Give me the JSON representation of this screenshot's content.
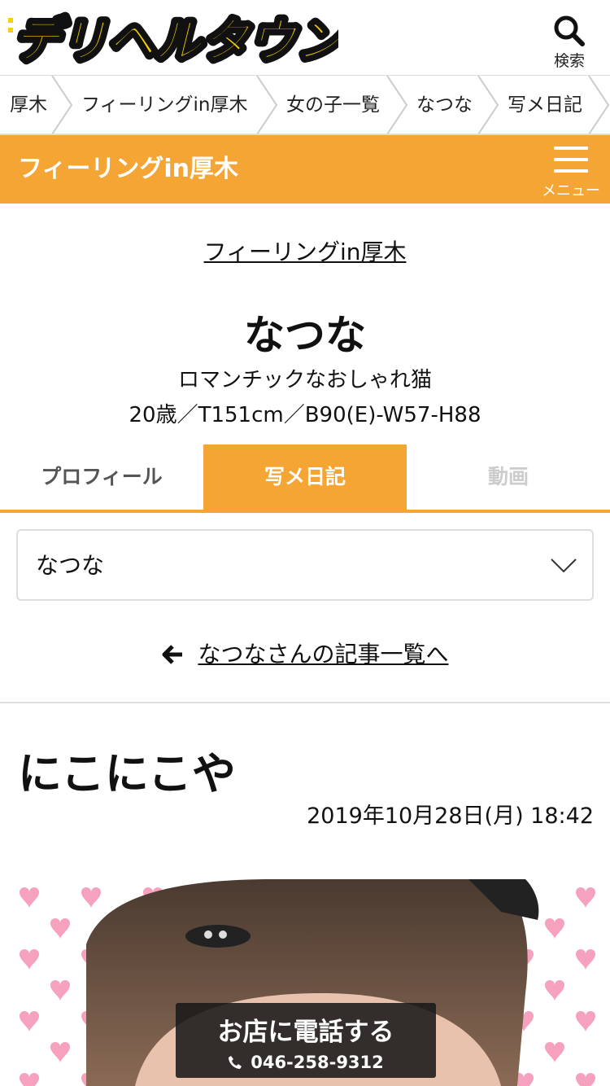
{
  "header": {
    "logo_text": "デリヘルタウン",
    "search_label": "検索"
  },
  "breadcrumb": [
    "厚木",
    "フィーリングin厚木",
    "女の子一覧",
    "なつな",
    "写メ日記"
  ],
  "shop_bar": {
    "name": "フィーリングin厚木",
    "menu_label": "メニュー",
    "color": "#f4a533"
  },
  "profile": {
    "shop_link": "フィーリングin厚木",
    "name": "なつな",
    "catchphrase": "ロマンチックなおしゃれ猫",
    "spec": "20歳／T151cm／B90(E)-W57-H88"
  },
  "tabs": [
    {
      "label": "プロフィール"
    },
    {
      "label": "写メ日記"
    },
    {
      "label": "動画"
    }
  ],
  "girl_select": {
    "value": "なつな"
  },
  "back_link": "なつなさんの記事一覧へ",
  "post": {
    "title": "にこにこや",
    "date": "2019年10月28日(月) 18:42"
  },
  "call": {
    "label": "お店に電話する",
    "phone": "046-258-9312"
  }
}
